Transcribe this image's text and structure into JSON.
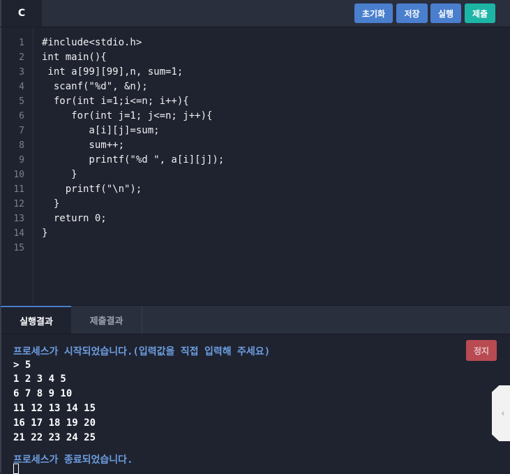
{
  "header": {
    "language": "C",
    "buttons": {
      "reset": "초기화",
      "save": "저장",
      "run": "실행",
      "submit": "제출"
    }
  },
  "editor": {
    "line_numbers": [
      "1",
      "2",
      "3",
      "4",
      "5",
      "6",
      "7",
      "8",
      "9",
      "10",
      "11",
      "12",
      "13",
      "14",
      "15"
    ],
    "lines": [
      "#include<stdio.h>",
      "int main(){",
      " int a[99][99],n, sum=1;",
      "  scanf(\"%d\", &n);",
      "  for(int i=1;i<=n; i++){",
      "     for(int j=1; j<=n; j++){",
      "        a[i][j]=sum;",
      "        sum++;",
      "        printf(\"%d \", a[i][j]);",
      "     }",
      "    printf(\"\\n\");",
      "  }",
      "  return 0;",
      "}",
      ""
    ]
  },
  "bottom": {
    "tabs": {
      "result": "실행결과",
      "submit_result": "제출결과"
    },
    "stop_label": "정지",
    "console": {
      "start_msg": "프로세스가 시작되었습니다.(입력값을 직접 입력해 주세요)",
      "input_line": "> 5",
      "output": [
        "1 2 3 4 5",
        "6 7 8 9 10",
        "11 12 13 14 15",
        "16 17 18 19 20",
        "21 22 23 24 25"
      ],
      "end_msg": "프로세스가 종료되었습니다."
    }
  },
  "icons": {
    "side_toggle": "chevron-left-icon"
  },
  "colors": {
    "accent": "#4a7fce",
    "submit": "#1cb5a6",
    "stop": "#b84a52",
    "background": "#1f2330"
  }
}
